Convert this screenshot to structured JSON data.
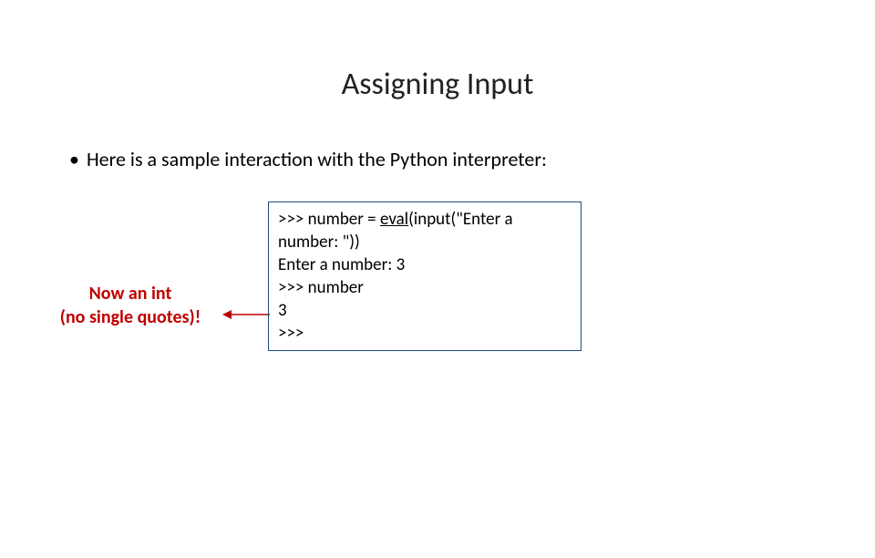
{
  "title": "Assigning Input",
  "bullet": "Here is a sample interaction with the Python interpreter:",
  "callout": {
    "line1": "Now an int",
    "line2": "(no single quotes)!"
  },
  "code": {
    "l1_prefix": ">>> number = ",
    "l1_fn": "eval",
    "l1_open": "(",
    "l1_inner": "input(\"Enter a ",
    "l2_inner": "number: \")",
    "l2_close": ")",
    "l3": "Enter a number: 3",
    "l4": ">>> number",
    "l5": "3",
    "l6": ">>>"
  },
  "colors": {
    "callout": "#bf0000",
    "box_border": "#1f4e79"
  }
}
